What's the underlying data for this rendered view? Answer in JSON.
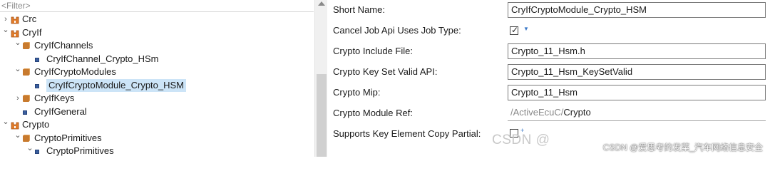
{
  "tree": {
    "filter_placeholder": "<Filter>",
    "rows": [
      {
        "label": "Crc",
        "indent": 0,
        "twisty": "›",
        "icon": "module"
      },
      {
        "label": "CryIf",
        "indent": 0,
        "twisty": "⌄",
        "icon": "module"
      },
      {
        "label": "CryIfChannels",
        "indent": 1,
        "twisty": "⌄",
        "icon": "container"
      },
      {
        "label": "CryIfChannel_Crypto_HSm",
        "indent": 2,
        "twisty": "",
        "icon": "item"
      },
      {
        "label": "CryIfCryptoModules",
        "indent": 1,
        "twisty": "⌄",
        "icon": "container"
      },
      {
        "label": "CryIfCryptoModule_Crypto_HSM",
        "indent": 2,
        "twisty": "",
        "icon": "item",
        "selected": true
      },
      {
        "label": "CryIfKeys",
        "indent": 1,
        "twisty": "›",
        "icon": "container"
      },
      {
        "label": "CryIfGeneral",
        "indent": 1,
        "twisty": "",
        "icon": "item"
      },
      {
        "label": "Crypto",
        "indent": 0,
        "twisty": "⌄",
        "icon": "module"
      },
      {
        "label": "CryptoPrimitives",
        "indent": 1,
        "twisty": "⌄",
        "icon": "container"
      },
      {
        "label": "CryptoPrimitives",
        "indent": 2,
        "twisty": "⌄",
        "icon": "item"
      }
    ]
  },
  "props": {
    "short_name": {
      "label": "Short Name:",
      "value": "CryIfCryptoModule_Crypto_HSM"
    },
    "cancel_job": {
      "label": "Cancel Job Api Uses Job Type:",
      "checked": true
    },
    "include_file": {
      "label": "Crypto Include File:",
      "value": "Crypto_11_Hsm.h"
    },
    "key_set_valid": {
      "label": "Crypto Key Set Valid API:",
      "value": "Crypto_11_Hsm_KeySetValid"
    },
    "mip": {
      "label": "Crypto Mip:",
      "value": "Crypto_11_Hsm"
    },
    "module_ref": {
      "label": "Crypto Module Ref:",
      "value_prefix": "/ActiveEcuC/",
      "value_suffix": "Crypto"
    },
    "key_copy": {
      "label": "Supports Key Element Copy Partial:",
      "checked": false
    }
  },
  "watermark": "CSDN @",
  "credit": "CSDN @爱思考的发菜_汽车网络信息安全",
  "colors": {
    "selection": "#cce4f7",
    "accent": "#3a78c8"
  }
}
